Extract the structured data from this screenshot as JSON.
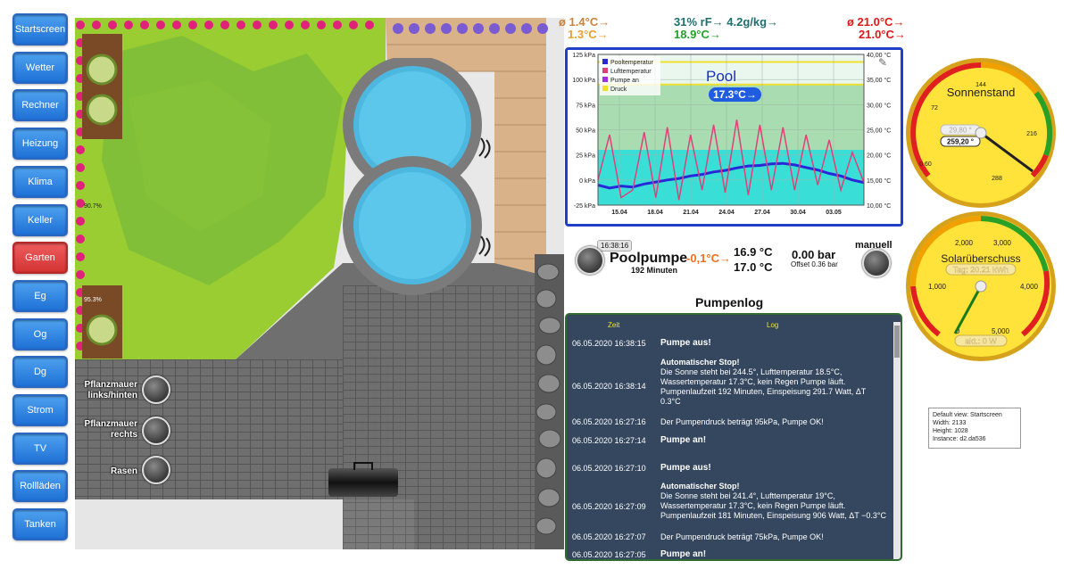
{
  "nav": {
    "items": [
      {
        "label": "Startscreen"
      },
      {
        "label": "Wetter"
      },
      {
        "label": "Rechner"
      },
      {
        "label": "Heizung"
      },
      {
        "label": "Klima"
      },
      {
        "label": "Keller"
      },
      {
        "label": "Garten",
        "active": true
      },
      {
        "label": "Eg"
      },
      {
        "label": "Og"
      },
      {
        "label": "Dg"
      },
      {
        "label": "Strom"
      },
      {
        "label": "TV"
      },
      {
        "label": "Rollläden"
      },
      {
        "label": "Tanken"
      }
    ]
  },
  "garden": {
    "bed_top_pct": "90.7%",
    "bed_bottom_pct": "95.3%",
    "controls": [
      {
        "label1": "Pflanzmauer",
        "label2": "links/hinten"
      },
      {
        "label1": "Pflanzmauer",
        "label2": "rechts"
      },
      {
        "label1": "Rasen",
        "label2": ""
      }
    ]
  },
  "header": {
    "left_min": "ø 1.4°C→",
    "left_max": "1.3°C→",
    "humidity": "31% rF→ 4.2g/kg→",
    "dewpoint": "18.9°C→",
    "right_min": "ø 21.0°C→",
    "right_max": "21.0°C→",
    "colors": {
      "left": "#d8822b",
      "humidity": "#1f6f6f",
      "dewpoint": "#22a22a",
      "right": "#e01818"
    }
  },
  "chart_data": {
    "type": "line",
    "title": "Pool",
    "current_value": "17.3°C→",
    "x_ticks": [
      "15.04",
      "18.04",
      "21.04",
      "24.04",
      "27.04",
      "30.04",
      "03.05"
    ],
    "y_left_ticks": [
      "125 kPa",
      "100 kPa",
      "75 kPa",
      "50 kPa",
      "25 kPa",
      "0 kPa",
      "-25 kPa"
    ],
    "y_left_range": [
      -25,
      125
    ],
    "y_right_ticks": [
      "40,00 °C",
      "35,00 °C",
      "30,00 °C",
      "25,00 °C",
      "20,00 °C",
      "15,00 °C",
      "10,00 °C"
    ],
    "y_right_range": [
      10,
      40
    ],
    "legend": [
      "Pooltemperatur",
      "Lufttemperatur",
      "Pumpe an",
      "Druck"
    ],
    "colors": {
      "Pooltemperatur": "#2828d8",
      "Lufttemperatur": "#e0407a",
      "Pumpe an": "#a030e0",
      "Druck": "#f0e030"
    },
    "pump_band_top_c": 34,
    "series": [
      {
        "name": "Pooltemperatur",
        "values": [
          14.0,
          13.4,
          13.8,
          13.6,
          14.2,
          14.6,
          15.0,
          15.3,
          15.8,
          16.1,
          16.6,
          16.9,
          17.4,
          17.8,
          17.9,
          18.2,
          18.3,
          18.0,
          17.5,
          17.0,
          16.3,
          15.8,
          15.0,
          14.5
        ]
      },
      {
        "name": "Lufttemperatur",
        "values": [
          15.0,
          24.0,
          11.5,
          13.0,
          24.5,
          11.5,
          25.5,
          11.0,
          24.0,
          13.0,
          26.0,
          12.5,
          27.0,
          12.0,
          26.0,
          13.0,
          25.5,
          13.0,
          24.0,
          14.0,
          23.0,
          13.0,
          20.5,
          14.5
        ]
      }
    ]
  },
  "pump": {
    "time_badge": "16:38:16",
    "name": "Poolpumpe",
    "minutes": "192 Minuten",
    "delta": "-0,1°C→",
    "temp_in": "16.9 °C",
    "temp_out": "17.0 °C",
    "pressure": "0.00 bar",
    "offset": "Offset 0.36 bar",
    "mode": "manuell"
  },
  "log": {
    "title": "Pumpenlog",
    "col_time": "Zeit",
    "col_log": "Log",
    "entries": [
      {
        "time": "06.05.2020 16:38:15",
        "text": "Pumpe aus!",
        "strong": true
      },
      {
        "time": "06.05.2020 16:38:14",
        "line1": "Automatischer Stop!",
        "line2": "Die Sonne steht bei 244.5°, Lufttemperatur 18.5°C,",
        "line3": "Wassertemperatur 17.3°C, kein Regen Pumpe läuft.",
        "line4": "Pumpenlaufzeit 192 Minuten, Einspeisung 291.7 Watt, ΔT",
        "line5": "0.3°C"
      },
      {
        "time": "06.05.2020 16:27:16",
        "text": "Der Pumpendruck beträgt 95kPa, Pumpe OK!"
      },
      {
        "time": "06.05.2020 16:27:14",
        "text": "Pumpe an!",
        "strong": true
      },
      {
        "time": "06.05.2020 16:27:10",
        "text": "Pumpe aus!",
        "strong": true
      },
      {
        "time": "06.05.2020 16:27:09",
        "line1": "Automatischer Stop!",
        "line2": "Die Sonne steht bei 241.4°, Lufttemperatur 19°C,",
        "line3": "Wassertemperatur 17.3°C, kein Regen Pumpe läuft.",
        "line4": "Pumpenlaufzeit 181 Minuten, Einspeisung 906 Watt, ΔT −0.3°C"
      },
      {
        "time": "06.05.2020 16:27:07",
        "text": "Der Pumpendruck beträgt 75kPa, Pumpe OK!"
      },
      {
        "time": "06.05.2020 16:27:05",
        "text": "Pumpe an!",
        "strong": true
      }
    ]
  },
  "gauge_sun": {
    "title": "Sonnenstand",
    "ticks": [
      "144",
      "72",
      "216",
      "0 60",
      "288"
    ],
    "ref_value": "29,80 °",
    "value": "259,20 °",
    "needle_deg": 259.2
  },
  "gauge_solar": {
    "title": "Solarüberschuss",
    "ticks": [
      "2,000",
      "3,000",
      "1,000",
      "4,000",
      "0",
      "5,000"
    ],
    "today": "Tag: 20.21 kWh",
    "current": "akt.: 0 W",
    "needle_value": 0
  },
  "info": {
    "line1": "Default view: Startscreen",
    "line2": "Width: 2133",
    "line3": "Height: 1028",
    "line4": "Instance: d2.da536"
  }
}
